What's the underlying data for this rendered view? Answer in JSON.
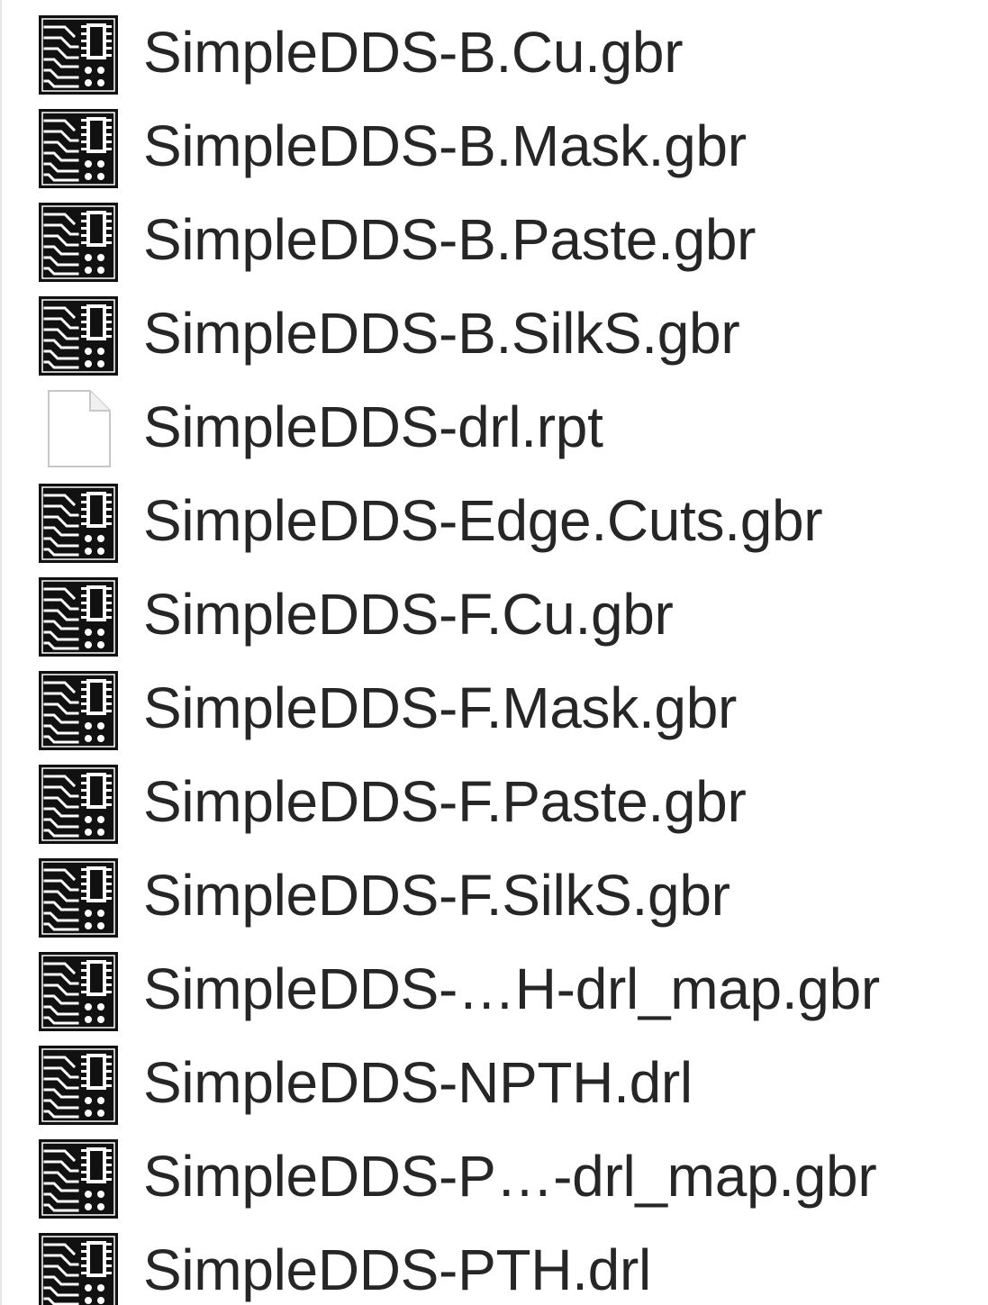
{
  "files": [
    {
      "name": "SimpleDDS-B.Cu.gbr",
      "icon": "gerber-file-icon"
    },
    {
      "name": "SimpleDDS-B.Mask.gbr",
      "icon": "gerber-file-icon"
    },
    {
      "name": "SimpleDDS-B.Paste.gbr",
      "icon": "gerber-file-icon"
    },
    {
      "name": "SimpleDDS-B.SilkS.gbr",
      "icon": "gerber-file-icon"
    },
    {
      "name": "SimpleDDS-drl.rpt",
      "icon": "blank-document-icon"
    },
    {
      "name": "SimpleDDS-Edge.Cuts.gbr",
      "icon": "gerber-file-icon"
    },
    {
      "name": "SimpleDDS-F.Cu.gbr",
      "icon": "gerber-file-icon"
    },
    {
      "name": "SimpleDDS-F.Mask.gbr",
      "icon": "gerber-file-icon"
    },
    {
      "name": "SimpleDDS-F.Paste.gbr",
      "icon": "gerber-file-icon"
    },
    {
      "name": "SimpleDDS-F.SilkS.gbr",
      "icon": "gerber-file-icon"
    },
    {
      "name": "SimpleDDS-…H-drl_map.gbr",
      "icon": "gerber-file-icon"
    },
    {
      "name": "SimpleDDS-NPTH.drl",
      "icon": "gerber-file-icon"
    },
    {
      "name": "SimpleDDS-P…-drl_map.gbr",
      "icon": "gerber-file-icon"
    },
    {
      "name": "SimpleDDS-PTH.drl",
      "icon": "gerber-file-icon"
    }
  ]
}
